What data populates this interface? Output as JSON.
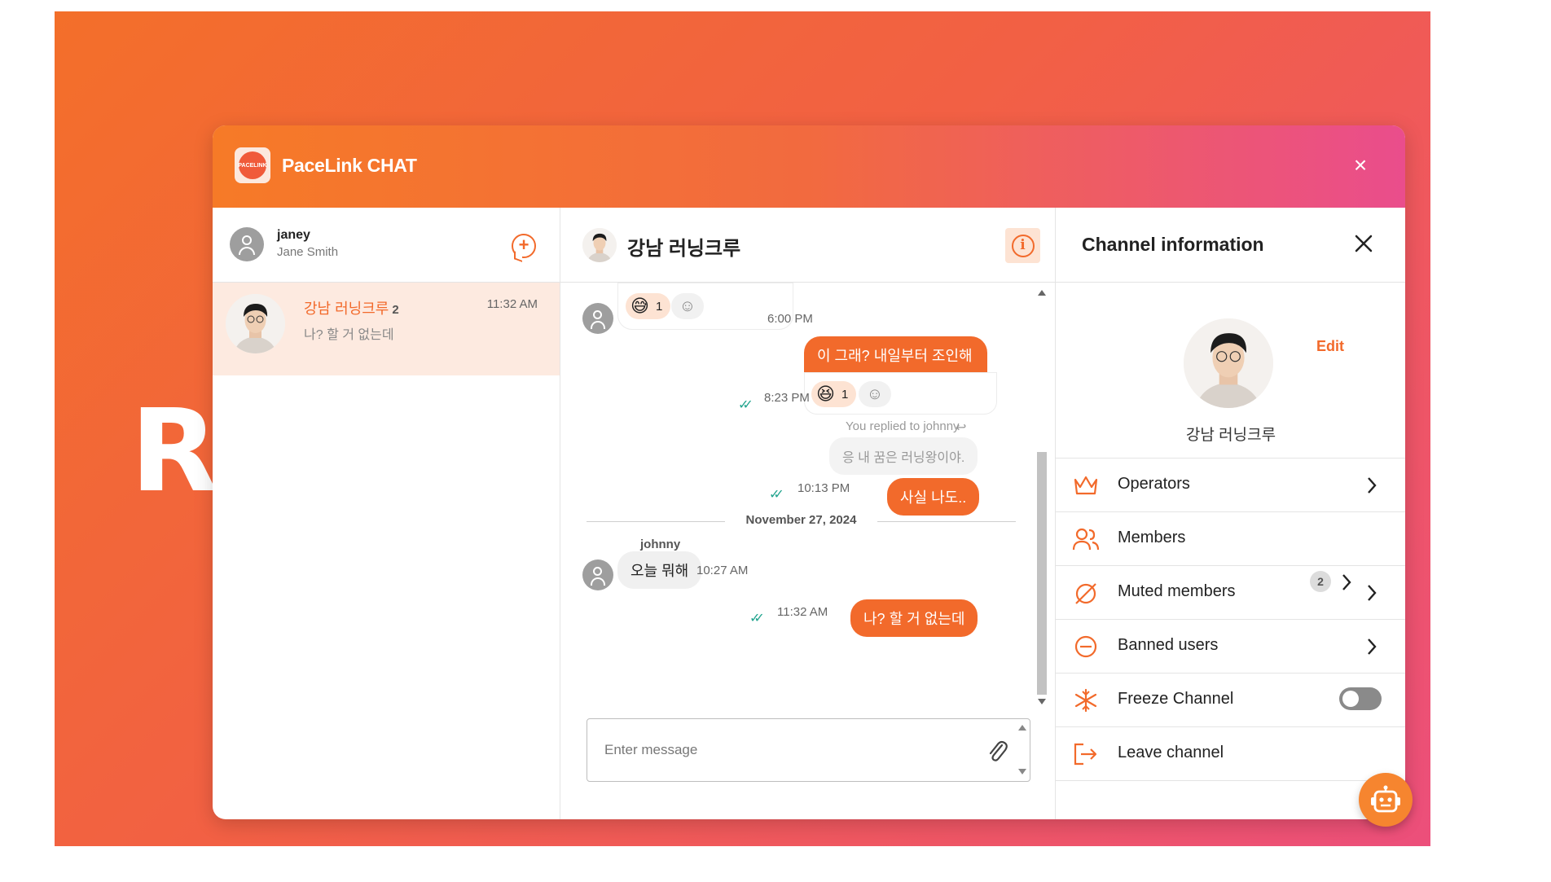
{
  "background": {
    "partial_text": "RU"
  },
  "app": {
    "title": "PaceLink CHAT",
    "logo_text": "PACELINK",
    "close_glyph": "×"
  },
  "current_user": {
    "nickname": "janey",
    "full_name": "Jane Smith"
  },
  "channel_list": [
    {
      "name": "강남 러닝크루",
      "member_count": "2",
      "time": "11:32 AM",
      "last_message": "나? 할 거 없는데"
    }
  ],
  "chat": {
    "title": "강남 러닝크루",
    "info_icon": "i",
    "messages": {
      "m1": {
        "reaction_emoji": "😅",
        "reaction_count": "1",
        "time": "6:00 PM"
      },
      "m2": {
        "text": "이 그래? 내일부터 조인해",
        "reaction_emoji": "😆",
        "reaction_count": "1",
        "time": "8:23 PM"
      },
      "m3": {
        "reply_hint": "You replied to johnny",
        "quoted": "응 내 꿈은 러닝왕이야.",
        "text": "사실 나도..",
        "time": "10:13 PM"
      },
      "date_separator": "November 27, 2024",
      "m4": {
        "sender": "johnny",
        "text": "오늘 뭐해",
        "time": "10:27 AM"
      },
      "m5": {
        "text": "나? 할 거 없는데",
        "time": "11:32 AM"
      }
    },
    "input": {
      "placeholder": "Enter message",
      "value": ""
    }
  },
  "channel_info": {
    "title": "Channel information",
    "edit_label": "Edit",
    "channel_name": "강남 러닝크루",
    "menu": [
      {
        "label": "Operators",
        "icon": "crown-icon"
      },
      {
        "label": "Members",
        "icon": "members-icon"
      },
      {
        "label": "Muted members",
        "icon": "muted-icon",
        "badge": "2"
      },
      {
        "label": "Banned users",
        "icon": "banned-icon"
      },
      {
        "label": "Freeze Channel",
        "icon": "snowflake-icon",
        "toggle": false
      },
      {
        "label": "Leave channel",
        "icon": "leave-icon"
      }
    ]
  },
  "colors": {
    "accent": "#f26a2b",
    "accent_light": "#fde3d3",
    "read_check": "#23a58f"
  }
}
